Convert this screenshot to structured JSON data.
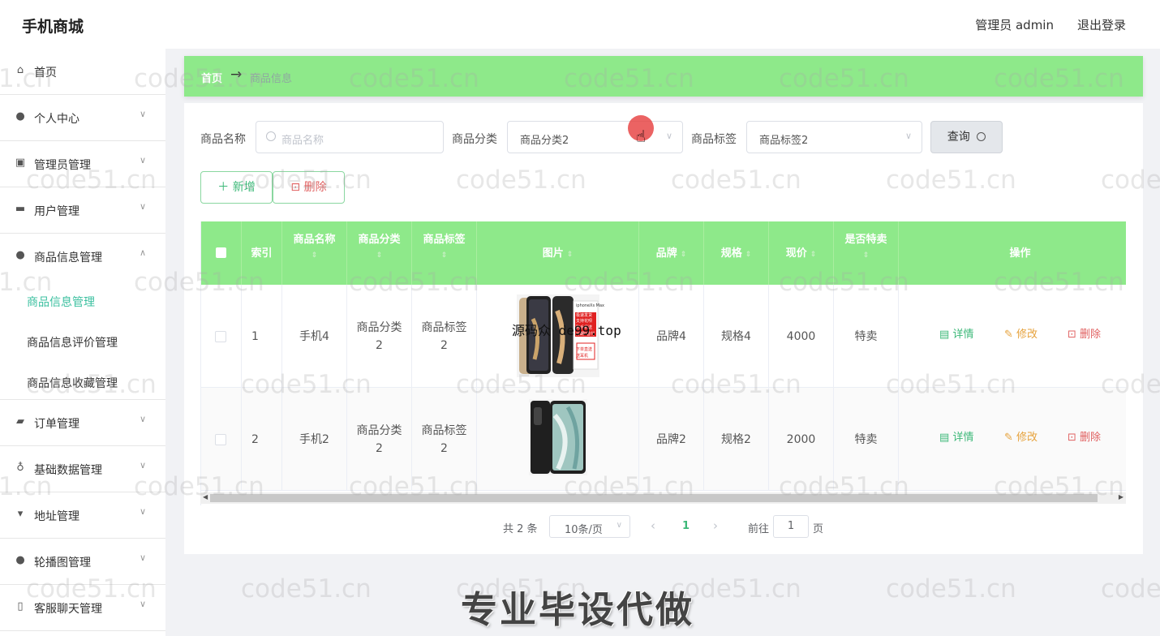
{
  "app": {
    "title": "手机商城"
  },
  "header": {
    "user": "管理员 admin",
    "logout": "退出登录"
  },
  "sidebar": {
    "items": [
      {
        "label": "首页",
        "icon": "home-icon"
      },
      {
        "label": "个人中心",
        "icon": "user-icon"
      },
      {
        "label": "管理员管理",
        "icon": "admin-icon"
      },
      {
        "label": "用户管理",
        "icon": "briefcase-icon"
      },
      {
        "label": "商品信息管理",
        "icon": "user-icon"
      },
      {
        "label": "订单管理",
        "icon": "ticket-icon"
      },
      {
        "label": "基础数据管理",
        "icon": "microphone-icon"
      },
      {
        "label": "地址管理",
        "icon": "signpost-icon"
      },
      {
        "label": "轮播图管理",
        "icon": "balloon-icon"
      },
      {
        "label": "客服聊天管理",
        "icon": "phone-icon"
      }
    ],
    "sub_items": [
      "商品信息管理",
      "商品信息评价管理",
      "商品信息收藏管理"
    ]
  },
  "breadcrumb": {
    "home": "首页",
    "arrow": "→",
    "current": "商品信息"
  },
  "filters": {
    "name_label": "商品名称",
    "name_placeholder": "商品名称",
    "category_label": "商品分类",
    "category_value": "商品分类2",
    "tag_label": "商品标签",
    "tag_value": "商品标签2",
    "query_button": "查询"
  },
  "actions": {
    "add": "新增",
    "delete": "删除"
  },
  "table": {
    "headers": {
      "index": "索引",
      "name": "商品名称",
      "category": "商品分类",
      "tag": "商品标签",
      "image": "图片",
      "brand": "品牌",
      "spec": "规格",
      "price": "现价",
      "special": "是否特卖",
      "ops": "操作"
    },
    "sort_glyph": "⇕",
    "rows": [
      {
        "index": "1",
        "name": "手机4",
        "category": "商品分类\n2",
        "category_a": "商品分类",
        "category_b": "2",
        "tag_a": "商品标签",
        "tag_b": "2",
        "brand": "品牌4",
        "spec": "规格4",
        "price": "4000",
        "special": "特卖"
      },
      {
        "index": "2",
        "name": "手机2",
        "category_a": "商品分类",
        "category_b": "2",
        "tag_a": "商品标签",
        "tag_b": "2",
        "brand": "品牌2",
        "spec": "规格2",
        "price": "2000",
        "special": "特卖"
      }
    ],
    "row_actions": {
      "detail": "详情",
      "edit": "修改",
      "delete": "删除"
    }
  },
  "pagination": {
    "total": "共 2 条",
    "page_size": "10条/页",
    "current_page": "1",
    "goto_label": "前往",
    "goto_value": "1",
    "page_suffix": "页"
  },
  "overlay": {
    "watermark": "code51.cn",
    "watermark_left_partial": "1.cn",
    "image_text": "源码众 de99.top",
    "banner": "专业毕设代做",
    "phone_box_text": [
      "iphoneXs Max",
      "极速发货",
      "支持花呗",
      "购手机送",
      "分期0首付",
      "下单直送",
      "送耳机"
    ]
  },
  "colors": {
    "accent_green": "#8ee98a",
    "link_green": "#3cb878",
    "active_teal": "#3cc0a0",
    "edit_orange": "#e6a23c",
    "delete_red": "#e06060"
  }
}
